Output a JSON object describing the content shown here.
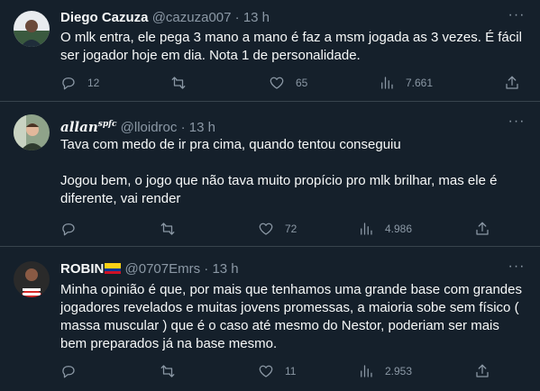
{
  "colors": {
    "background": "#15202b",
    "divider": "#38444d",
    "text_primary": "#f7f9f9",
    "text_secondary": "#8b98a5"
  },
  "tweets": [
    {
      "display_name": "Diego Cazuza",
      "handle": "@cazuza007",
      "separator": "·",
      "time": "13 h",
      "text": "O mlk entra, ele pega 3 mano a mano é faz a msm jogada as 3 vezes. É fácil ser jogador hoje em dia. Nota 1 de personalidade.",
      "replies": "12",
      "retweets": "",
      "likes": "65",
      "views": "7.661"
    },
    {
      "display_name": "allan",
      "name_suffix": "spfc",
      "handle": "@lloidroc",
      "separator": "·",
      "time": "13 h",
      "text": "Tava com medo de ir pra cima, quando tentou conseguiu\n\nJogou bem, o jogo que não tava muito propício pro mlk brilhar, mas ele é diferente, vai render",
      "replies": "",
      "retweets": "",
      "likes": "72",
      "views": "4.986"
    },
    {
      "display_name": "ROBIN",
      "name_emoji": "colombia-flag-icon",
      "handle": "@0707Emrs",
      "separator": "·",
      "time": "13 h",
      "text": "Minha opinião é que, por mais que tenhamos uma grande base com grandes jogadores revelados e muitas jovens promessas, a maioria sobe sem físico ( massa muscular ) que é o caso até mesmo do Nestor, poderiam ser mais bem preparados já na base mesmo.",
      "replies": "",
      "retweets": "",
      "likes": "11",
      "views": "2.953"
    }
  ]
}
